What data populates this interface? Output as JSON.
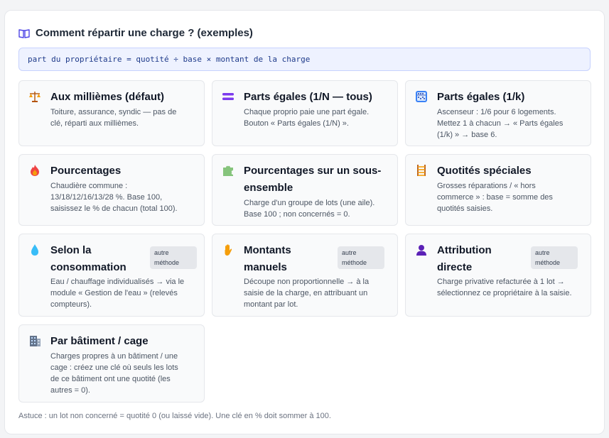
{
  "header": {
    "title": "Comment répartir une charge ? (exemples)",
    "icon": "open-book-icon"
  },
  "formula": "part du propriétaire = quotité ÷ base × montant de la charge",
  "cards": [
    {
      "title": "Aux millièmes (défaut)",
      "icon": "balance-scale-icon",
      "desc": [
        "Toiture, assurance, syndic — pas de",
        "clé, réparti aux millièmes."
      ]
    },
    {
      "title": "Parts égales (1/N — tous)",
      "icon": "equals-icon",
      "desc": [
        "Chaque proprio paie une part égale.",
        "Bouton « Parts égales (1/N) »."
      ]
    },
    {
      "title": "Parts égales (1/k)",
      "icon": "abacus-icon",
      "desc": [
        "Ascenseur : 1/6 pour 6 logements.",
        "Mettez 1 à chacun → « Parts égales",
        "(1/k) » → base 6."
      ]
    },
    {
      "title": "Pourcentages",
      "icon": "fire-icon",
      "desc": [
        "Chaudière commune :",
        "13/18/12/16/13/28 %. Base 100,",
        "saisissez le % de chacun (total 100)."
      ]
    },
    {
      "title_lines": [
        "Pourcentages sur un sous-",
        "ensemble"
      ],
      "icon": "puzzle-piece-icon",
      "desc": [
        "Charge d'un groupe de lots (une aile).",
        "Base 100 ; non concernés = 0."
      ]
    },
    {
      "title": "Quotités spéciales",
      "icon": "ladder-icon",
      "desc": [
        "Grosses réparations / « hors",
        "commerce » : base = somme des",
        "quotités saisies."
      ]
    },
    {
      "title_lines": [
        "Selon la",
        "consommation"
      ],
      "icon": "water-drop-icon",
      "badge": [
        "autre",
        "méthode"
      ],
      "desc": [
        "Eau / chauffage individualisés → via le",
        "module « Gestion de l'eau » (relevés",
        "compteurs)."
      ]
    },
    {
      "title_lines": [
        "Montants",
        "manuels"
      ],
      "icon": "raised-hand-icon",
      "badge": [
        "autre",
        "méthode"
      ],
      "desc": [
        "Découpe non proportionnelle → à la",
        "saisie de la charge, en attribuant un",
        "montant par lot."
      ]
    },
    {
      "title_lines": [
        "Attribution",
        "directe"
      ],
      "icon": "person-silhouette-icon",
      "badge": [
        "autre",
        "méthode"
      ],
      "desc": [
        "Charge privative refacturée à 1 lot →",
        "sélectionnez ce propriétaire à la saisie."
      ]
    },
    {
      "title": "Par bâtiment / cage",
      "icon": "office-building-icon",
      "desc": [
        "Charges propres à un bâtiment / une",
        "cage : créez une clé où seuls les lots",
        "de ce bâtiment ont une quotité (les",
        "autres = 0)."
      ]
    }
  ],
  "footer": {
    "tip": "Astuce : un lot non concerné = quotité 0 (ou laissé vide). Une clé en % doit sommer à 100."
  },
  "colors": {
    "accent": "#4f46e5",
    "formula_bg": "#eef2ff",
    "card_bg": "#f9fafb",
    "badge_bg": "#e5e7eb"
  }
}
